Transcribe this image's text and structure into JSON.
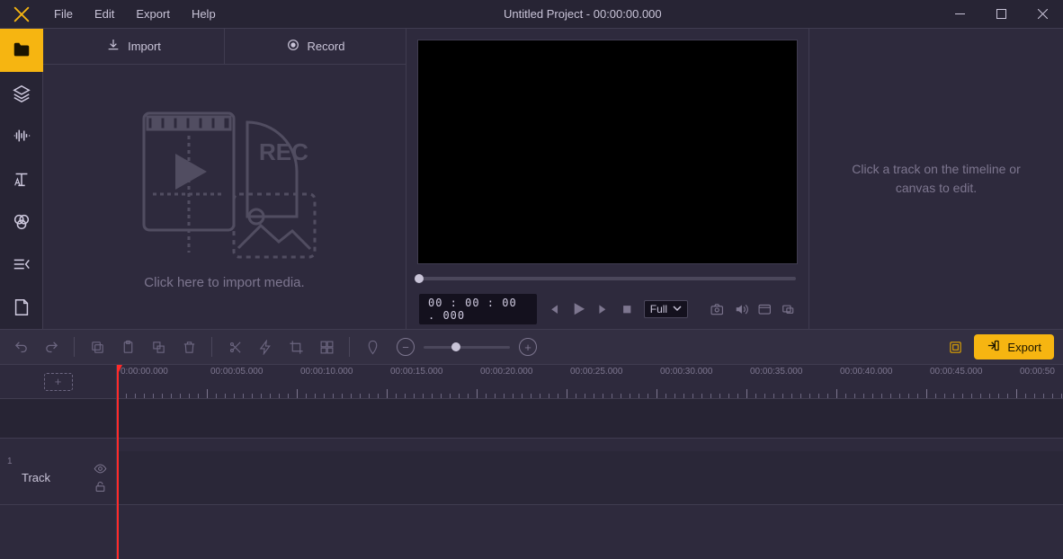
{
  "title": "Untitled Project - 00:00:00.000",
  "menubar": {
    "file": "File",
    "edit": "Edit",
    "export": "Export",
    "help": "Help"
  },
  "media": {
    "import_tab": "Import",
    "record_tab": "Record",
    "drop_hint": "Click here to import media."
  },
  "preview": {
    "timecode": "00 : 00 : 00 . 000",
    "fit_label": "Full"
  },
  "props": {
    "empty": "Click a track on the timeline or canvas to edit."
  },
  "toolbar": {
    "export": "Export"
  },
  "timeline": {
    "track1_num": "1",
    "track1_name": "Track",
    "ruler": [
      "0:00:00.000",
      "00:00:05.000",
      "00:00:10.000",
      "00:00:15.000",
      "00:00:20.000",
      "00:00:25.000",
      "00:00:30.000",
      "00:00:35.000",
      "00:00:40.000",
      "00:00:45.000",
      "00:00:50"
    ]
  }
}
